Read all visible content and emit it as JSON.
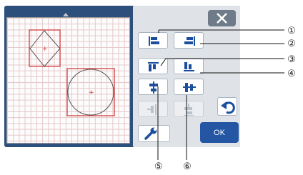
{
  "panel": {
    "ok_label": "OK"
  },
  "callouts": [
    "①",
    "②",
    "③",
    "④",
    "⑤",
    "⑥"
  ],
  "colors": {
    "device_frame": "#2c4f7c",
    "panel_bg": "#dfe3e8",
    "icon_blue": "#1b4f9e",
    "ok_button": "#2456a3",
    "shape_outline": "#d32f2f"
  },
  "icons": [
    "align-left-icon",
    "align-right-icon",
    "align-top-icon",
    "align-bottom-icon",
    "align-center-horizontal-icon",
    "align-center-vertical-icon",
    "distribute-horizontal-icon",
    "distribute-vertical-icon",
    "undo-icon",
    "wrench-icon",
    "close-icon"
  ]
}
